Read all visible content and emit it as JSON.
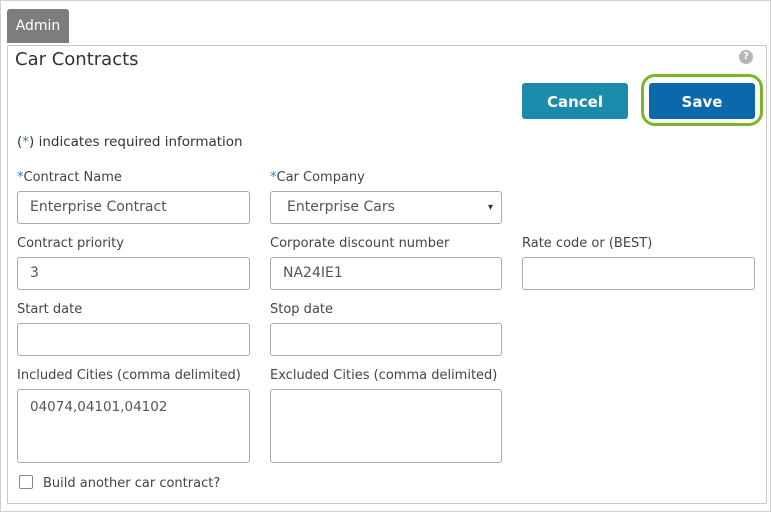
{
  "admin_tab": "Admin",
  "page_title": "Car Contracts",
  "help_icon": "?",
  "buttons": {
    "cancel": "Cancel",
    "save": "Save"
  },
  "required_note": {
    "star": "*",
    "prefix": "(",
    "suffix": ") indicates required information"
  },
  "fields": {
    "contract_name": {
      "star": "*",
      "label": "Contract Name",
      "value": "Enterprise Contract"
    },
    "car_company": {
      "star": "*",
      "label": "Car Company",
      "value": "Enterprise Cars",
      "caret": "▾"
    },
    "contract_priority": {
      "label": "Contract priority",
      "value": "3"
    },
    "corporate_discount": {
      "label": "Corporate discount number",
      "value": "NA24IE1"
    },
    "rate_code": {
      "label": "Rate code or (BEST)",
      "value": ""
    },
    "start_date": {
      "label": "Start date",
      "value": ""
    },
    "stop_date": {
      "label": "Stop date",
      "value": ""
    },
    "included_cities": {
      "label": "Included Cities (comma delimited)",
      "value": "04074,04101,04102"
    },
    "excluded_cities": {
      "label": "Excluded Cities (comma delimited)",
      "value": ""
    }
  },
  "checkbox": {
    "label": "Build another car contract?",
    "checked": false
  },
  "colors": {
    "cancel": "#1b8bab",
    "save": "#0a69aa",
    "highlight": "#7ab52a",
    "required_star": "#2a7fc0"
  }
}
